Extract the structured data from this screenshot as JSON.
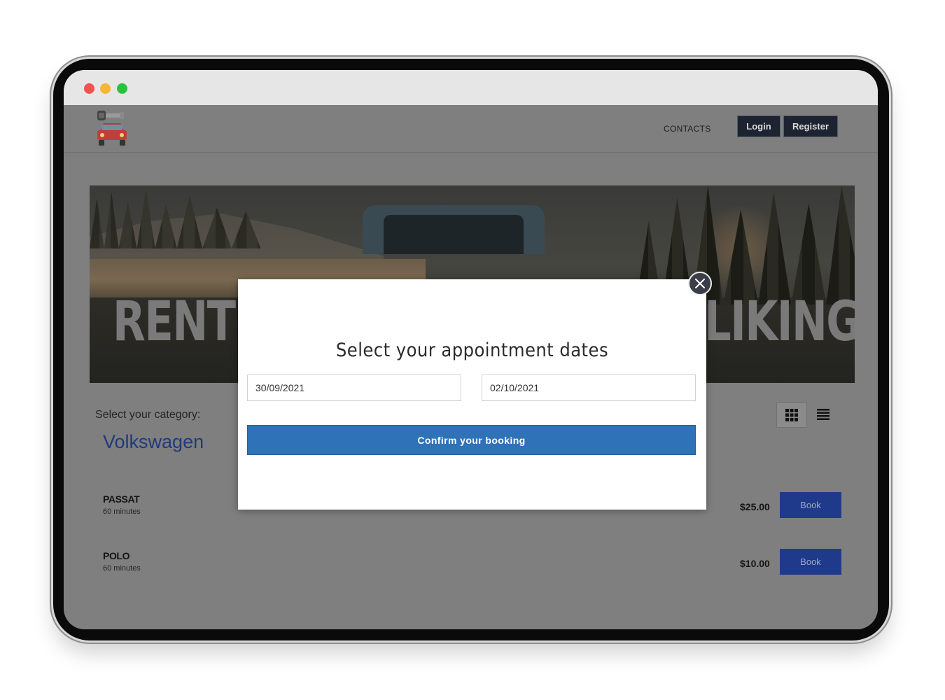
{
  "header": {
    "contacts_label": "CONTACTS",
    "login_label": "Login",
    "register_label": "Register",
    "logo_icon": "car-key-logo-icon"
  },
  "hero": {
    "text_left": "RENT A",
    "text_right": "LIKING!"
  },
  "category": {
    "label": "Select your category:",
    "value": "Volkswagen"
  },
  "view_toggle": {
    "grid_icon": "grid-view-icon",
    "list_icon": "list-view-icon"
  },
  "services": [
    {
      "name": "PASSAT",
      "duration": "60 minutes",
      "price": "$25.00",
      "book_label": "Book"
    },
    {
      "name": "POLO",
      "duration": "60 minutes",
      "price": "$10.00",
      "book_label": "Book"
    }
  ],
  "modal": {
    "title": "Select your appointment dates",
    "start_date": "30/09/2021",
    "end_date": "02/10/2021",
    "confirm_label": "Confirm your booking",
    "close_icon": "close-icon"
  },
  "colors": {
    "accent": "#2f72b8",
    "book_button": "#1f3a8a",
    "header_button": "#1d2331",
    "category_text": "#1f3a7e",
    "overlay": "#7f7f7f"
  }
}
